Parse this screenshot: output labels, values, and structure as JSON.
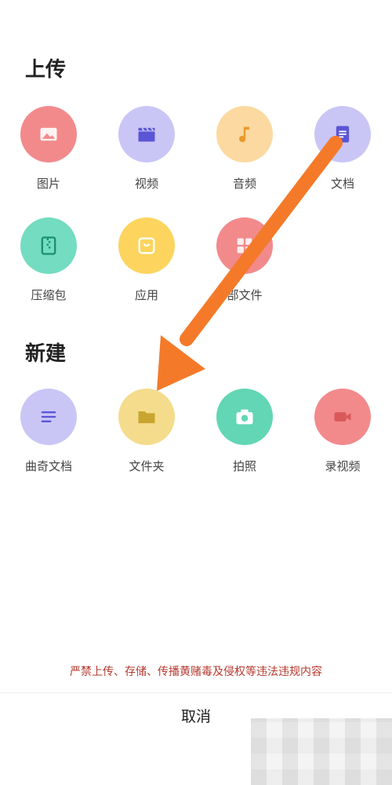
{
  "upload": {
    "title": "上传",
    "items": [
      {
        "label": "图片",
        "color": "#f28a8c",
        "icon": "image-icon"
      },
      {
        "label": "视频",
        "color": "#c9c6f6",
        "icon": "video-clapper-icon"
      },
      {
        "label": "音频",
        "color": "#fcd9a0",
        "icon": "music-note-icon"
      },
      {
        "label": "文档",
        "color": "#c9c6f6",
        "icon": "document-icon"
      },
      {
        "label": "压缩包",
        "color": "#74dcc0",
        "icon": "zip-archive-icon"
      },
      {
        "label": "应用",
        "color": "#fcd45e",
        "icon": "app-bag-icon"
      },
      {
        "label": "部文件",
        "color": "#f28a8c",
        "icon": "grid-files-icon"
      }
    ]
  },
  "create": {
    "title": "新建",
    "items": [
      {
        "label": "曲奇文档",
        "color": "#c9c6f6",
        "icon": "text-lines-icon"
      },
      {
        "label": "文件夹",
        "color": "#f4dc8c",
        "icon": "folder-icon"
      },
      {
        "label": "拍照",
        "color": "#62d6b5",
        "icon": "camera-icon"
      },
      {
        "label": "录视频",
        "color": "#f28a8c",
        "icon": "video-camera-icon"
      }
    ]
  },
  "notice": "严禁上传、存储、传播黄赌毒及侵权等违法违规内容",
  "cancel_label": "取消",
  "accent_arrow_color": "#f47a2a"
}
